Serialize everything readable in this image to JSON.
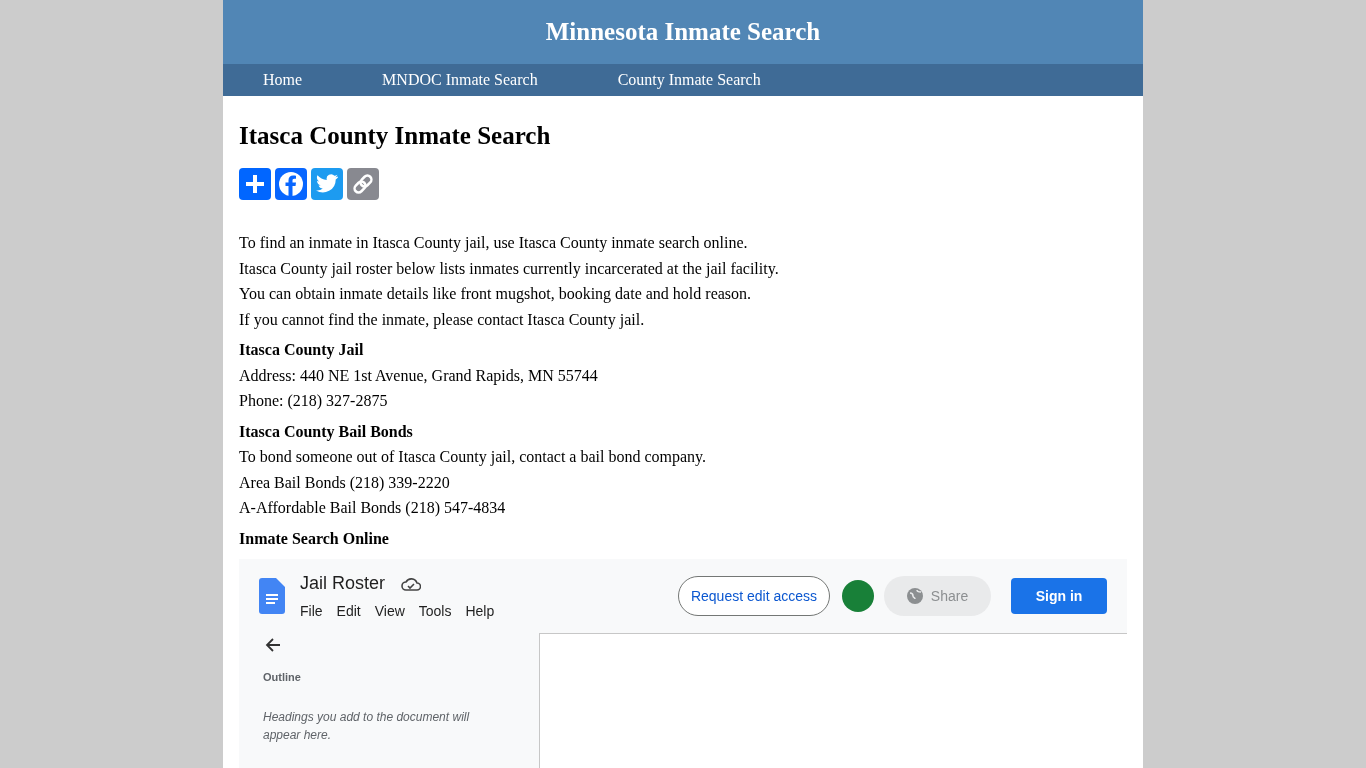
{
  "site_title": "Minnesota Inmate Search",
  "nav": [
    {
      "label": "Home"
    },
    {
      "label": "MNDOC Inmate Search"
    },
    {
      "label": "County Inmate Search"
    }
  ],
  "page_title": "Itasca County Inmate Search",
  "intro_lines": [
    "To find an inmate in Itasca County jail, use Itasca County inmate search online.",
    "Itasca County jail roster below lists inmates currently incarcerated at the jail facility.",
    "You can obtain inmate details like front mugshot, booking date and hold reason.",
    "If you cannot find the inmate, please contact Itasca County jail."
  ],
  "sections": [
    {
      "heading": "Itasca County Jail",
      "lines": [
        "Address: 440 NE 1st Avenue, Grand Rapids, MN 55744",
        "Phone: (218) 327-2875"
      ]
    },
    {
      "heading": "Itasca County Bail Bonds",
      "lines": [
        "To bond someone out of Itasca County jail, contact a bail bond company.",
        "Area Bail Bonds (218) 339-2220",
        "A-Affordable Bail Bonds (218) 547-4834"
      ]
    },
    {
      "heading": "Inmate Search Online"
    }
  ],
  "embed": {
    "doc_title": "Jail Roster",
    "menu": [
      "File",
      "Edit",
      "View",
      "Tools",
      "Help"
    ],
    "request_button": "Request edit access",
    "share_button": "Share",
    "signin_button": "Sign in",
    "outline_label": "Outline",
    "outline_hint": "Headings you add to the document will appear here."
  }
}
